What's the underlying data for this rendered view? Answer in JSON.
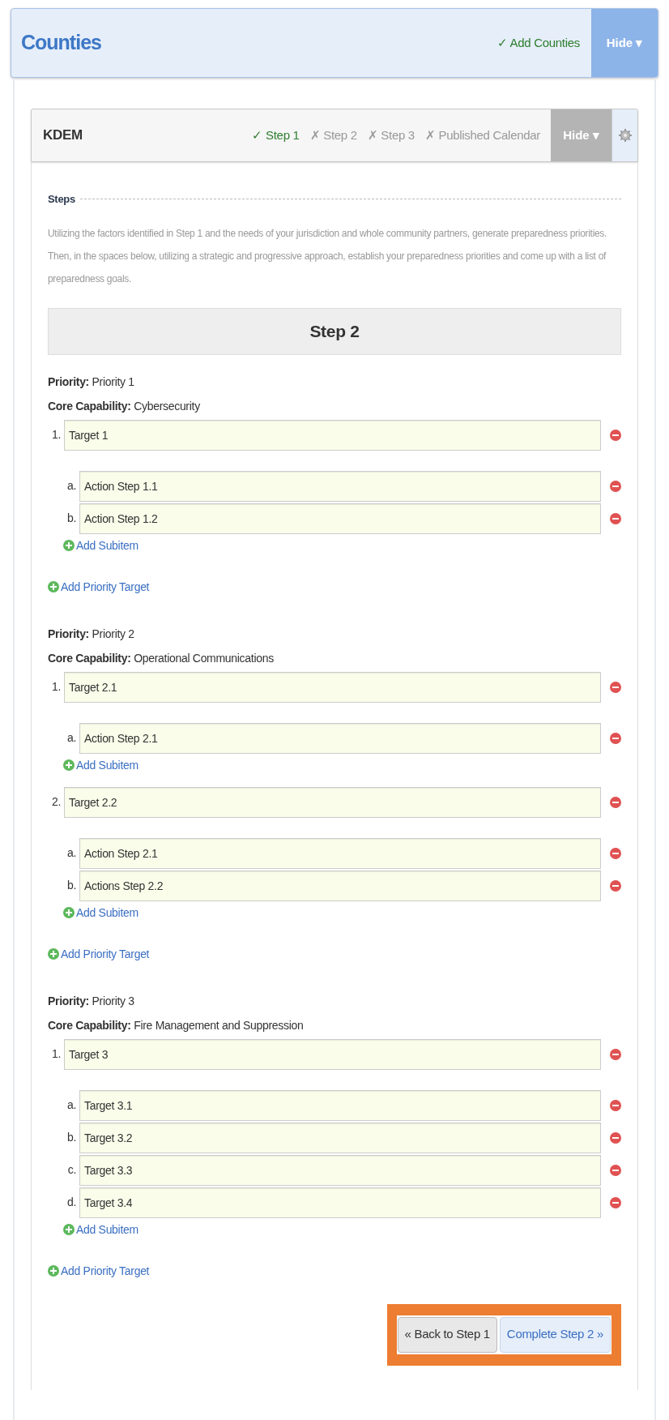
{
  "header": {
    "title": "Counties",
    "status": {
      "mark": "✓",
      "label": "Add Counties"
    },
    "hide_button": {
      "label": "Hide",
      "caret": "▾"
    }
  },
  "panel": {
    "title": "KDEM",
    "steps": [
      {
        "mark": "✓",
        "label": "Step 1",
        "done": true
      },
      {
        "mark": "✗",
        "label": "Step 2",
        "done": false
      },
      {
        "mark": "✗",
        "label": "Step 3",
        "done": false
      },
      {
        "mark": "✗",
        "label": "Published Calendar",
        "done": false
      }
    ],
    "hide_button": {
      "label": "Hide",
      "caret": "▾"
    }
  },
  "section_label": "Steps",
  "instructions": "Utilizing the factors identified in Step 1 and the needs of your jurisdiction and whole community partners, generate preparedness priorities. Then, in the spaces below, utilizing a strategic and progressive approach, establish your preparedness priorities and come up with a list of preparedness goals.",
  "step_heading": "Step 2",
  "priorities": [
    {
      "priority_label": "Priority:",
      "priority": "Priority 1",
      "capability_label": "Core Capability:",
      "capability": "Cybersecurity",
      "add_target": "Add Priority Target",
      "targets": [
        {
          "number": "1.",
          "value": "Target 1",
          "add_subitem": "Add Subitem",
          "children": [
            {
              "letter": "a.",
              "value": "Action Step 1.1"
            },
            {
              "letter": "b.",
              "value": "Action Step 1.2"
            }
          ]
        }
      ]
    },
    {
      "priority_label": "Priority:",
      "priority": "Priority 2",
      "capability_label": "Core Capability:",
      "capability": "Operational Communications",
      "add_target": "Add Priority Target",
      "targets": [
        {
          "number": "1.",
          "value": "Target 2.1",
          "add_subitem": "Add Subitem",
          "children": [
            {
              "letter": "a.",
              "value": "Action Step 2.1"
            }
          ]
        },
        {
          "number": "2.",
          "value": "Target 2.2",
          "add_subitem": "Add Subitem",
          "children": [
            {
              "letter": "a.",
              "value": "Action Step 2.1"
            },
            {
              "letter": "b.",
              "value": "Actions Step 2.2"
            }
          ]
        }
      ]
    },
    {
      "priority_label": "Priority:",
      "priority": "Priority 3",
      "capability_label": "Core Capability:",
      "capability": "Fire Management and Suppression",
      "add_target": "Add Priority Target",
      "targets": [
        {
          "number": "1.",
          "value": "Target 3",
          "add_subitem": "Add Subitem",
          "children": [
            {
              "letter": "a.",
              "value": "Target 3.1"
            },
            {
              "letter": "b.",
              "value": "Target 3.2"
            },
            {
              "letter": "c.",
              "value": "Target 3.3"
            },
            {
              "letter": "d.",
              "value": "Target 3.4"
            }
          ]
        }
      ]
    }
  ],
  "buttons": [
    {
      "label": "« Back to Step 1",
      "kind": "secondary"
    },
    {
      "label": "Complete Step 2 »",
      "kind": "primary"
    }
  ]
}
